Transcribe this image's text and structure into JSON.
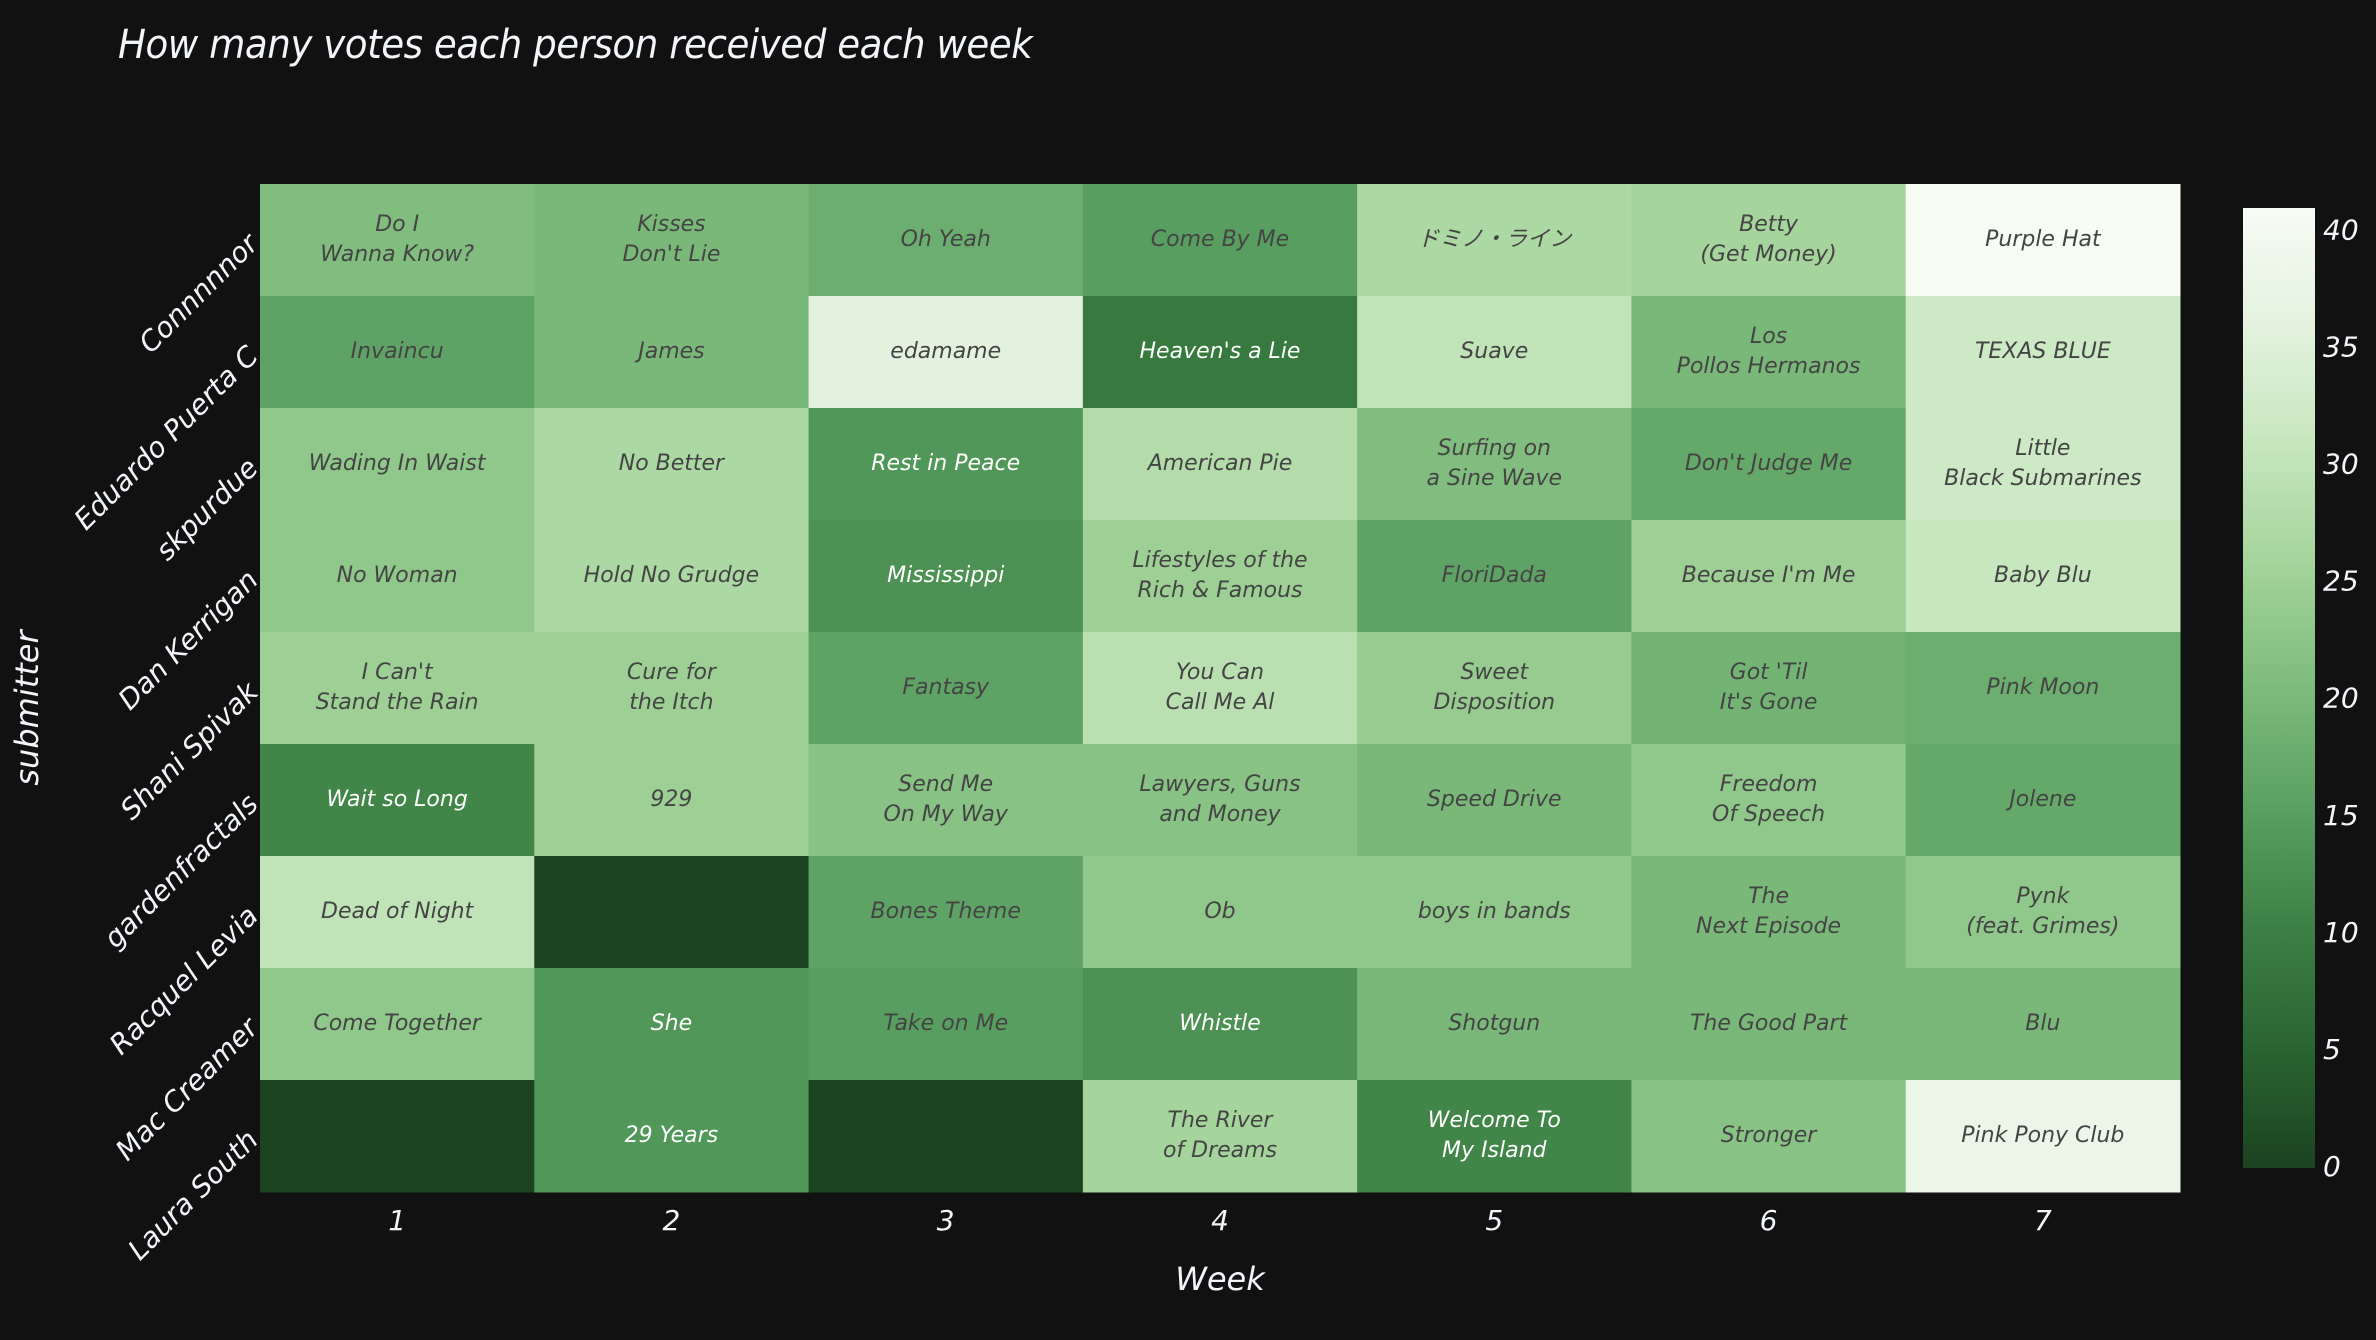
{
  "chart_data": {
    "type": "heatmap",
    "title": "How many votes each person received each week",
    "xlabel": "Week",
    "ylabel": "submitter",
    "x": [
      "1",
      "2",
      "3",
      "4",
      "5",
      "6",
      "7"
    ],
    "y": [
      "Connnnnor",
      "Eduardo Puerta C",
      "skpurdue",
      "Dan Kerrigan",
      "Shani Spivak",
      "gardenfractals",
      "Racquel Levia",
      "Mac Creamer",
      "Laura South"
    ],
    "values": [
      [
        21,
        20,
        18,
        15,
        27,
        26,
        41
      ],
      [
        16,
        20,
        36,
        9,
        30,
        20,
        32
      ],
      [
        23,
        27,
        14,
        28,
        21,
        17,
        32
      ],
      [
        23,
        27,
        13,
        25,
        16,
        25,
        31
      ],
      [
        25,
        25,
        16,
        29,
        24,
        19,
        18
      ],
      [
        11,
        25,
        22,
        22,
        20,
        23,
        17
      ],
      [
        30,
        0,
        16,
        23,
        23,
        20,
        23
      ],
      [
        23,
        14,
        15,
        13,
        20,
        20,
        20
      ],
      [
        0,
        14,
        0,
        26,
        11,
        22,
        38
      ]
    ],
    "labels": [
      [
        "Do I\nWanna Know?",
        "Kisses\nDon't Lie",
        "Oh Yeah",
        "Come By Me",
        "ドミノ・ライン",
        "Betty\n(Get Money)",
        "Purple Hat"
      ],
      [
        "Invaincu",
        "James",
        "edamame",
        "Heaven's a Lie",
        "Suave",
        "Los\nPollos Hermanos",
        "TEXAS BLUE"
      ],
      [
        "Wading In Waist",
        "No Better",
        "Rest in Peace",
        "American Pie",
        "Surfing on\na Sine Wave",
        "Don't Judge Me",
        "Little\nBlack Submarines"
      ],
      [
        "No Woman",
        "Hold No Grudge",
        "Mississippi",
        "Lifestyles of the\nRich & Famous",
        "FloriDada",
        "Because I'm Me",
        "Baby Blu"
      ],
      [
        "I Can't\nStand the Rain",
        "Cure for\nthe Itch",
        "Fantasy",
        "You Can\nCall Me Al",
        "Sweet\nDisposition",
        "Got 'Til\nIt's Gone",
        "Pink Moon"
      ],
      [
        "Wait so Long",
        "929",
        "Send Me\nOn My Way",
        "Lawyers, Guns\nand Money",
        "Speed Drive",
        "Freedom\nOf Speech",
        "Jolene"
      ],
      [
        "Dead of Night",
        "",
        "Bones Theme",
        "Ob",
        "boys in bands",
        "The\nNext Episode",
        "Pynk\n(feat. Grimes)"
      ],
      [
        "Come Together",
        "She",
        "Take on Me",
        "Whistle",
        "Shotgun",
        "The Good Part",
        "Blu"
      ],
      [
        "",
        "29 Years",
        "",
        "The River\nof Dreams",
        "Welcome To\nMy Island",
        "Stronger",
        "Pink Pony Club"
      ]
    ],
    "zlim": [
      0,
      41
    ],
    "colorbar": {
      "ticks": [
        0,
        5,
        10,
        15,
        20,
        25,
        30,
        35,
        40
      ],
      "colorscale": [
        [
          0.0,
          "#1b4320"
        ],
        [
          0.125,
          "#2a6432"
        ],
        [
          0.25,
          "#3d8045"
        ],
        [
          0.375,
          "#5aa062"
        ],
        [
          0.5,
          "#7dbb7c"
        ],
        [
          0.625,
          "#a3d39a"
        ],
        [
          0.75,
          "#c6e6bd"
        ],
        [
          0.875,
          "#e3f2de"
        ],
        [
          1.0,
          "#f7fcf5"
        ]
      ]
    },
    "legend_position": "right",
    "background": "#111111",
    "text_dark_color": "#444444",
    "text_light_color": "#ffffff"
  }
}
